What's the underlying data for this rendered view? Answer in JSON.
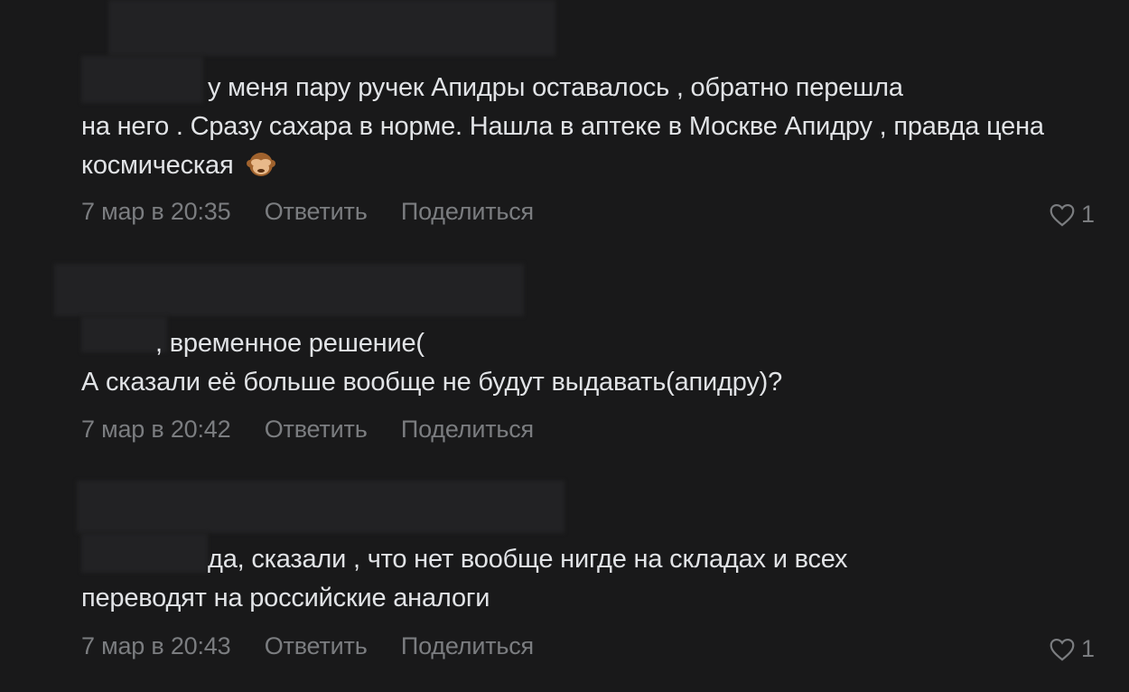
{
  "comments": [
    {
      "text_line1": "у меня пару ручек Апидры оставалось , обратно перешла",
      "text_rest": "на него . Сразу сахара в норме. Нашла в аптеке в Москве Апидру , правда цена космическая",
      "emoji": "see-no-evil-monkey-icon",
      "date": "7 мар в 20:35",
      "reply_label": "Ответить",
      "share_label": "Поделиться",
      "likes": "1"
    },
    {
      "text_line1": ", временное решение(",
      "text_rest": "А сказали её больше вообще не будут выдавать(апидру)?",
      "date": "7 мар в 20:42",
      "reply_label": "Ответить",
      "share_label": "Поделиться"
    },
    {
      "text_line1": "да, сказали , что нет вообще нигде на складах и всех",
      "text_rest": "переводят на российские аналоги",
      "date": "7 мар в 20:43",
      "reply_label": "Ответить",
      "share_label": "Поделиться",
      "likes": "1"
    }
  ],
  "colors": {
    "background": "#19191a",
    "text": "#e1e3e6",
    "meta": "#7b7d80"
  }
}
